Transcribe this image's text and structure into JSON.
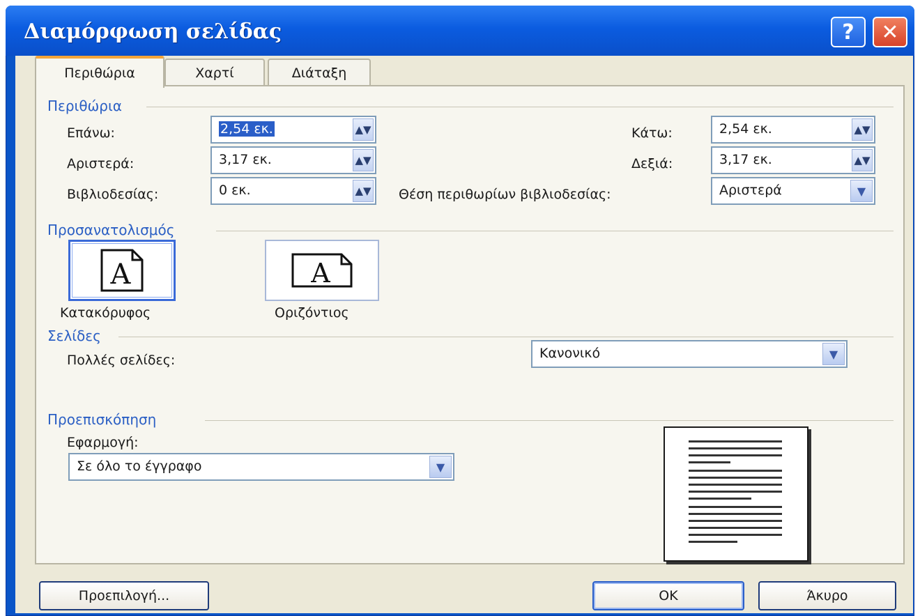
{
  "window": {
    "title": "Διαμόρφωση σελίδας",
    "help_label": "?",
    "close_label": "✕"
  },
  "tabs": [
    {
      "label": "Περιθώρια",
      "active": true
    },
    {
      "label": "Χαρτί",
      "active": false
    },
    {
      "label": "Διάταξη",
      "active": false
    }
  ],
  "margins": {
    "group_label": "Περιθώρια",
    "top_label": "Επάνω:",
    "top_value": "2,54 εκ.",
    "bottom_label": "Κάτω:",
    "bottom_value": "2,54 εκ.",
    "left_label": "Αριστερά:",
    "left_value": "3,17 εκ.",
    "right_label": "Δεξιά:",
    "right_value": "3,17 εκ.",
    "gutter_label": "Βιβλιοδεσίας:",
    "gutter_value": "0 εκ.",
    "gutter_pos_label": "Θέση περιθωρίων βιβλιοδεσίας:",
    "gutter_pos_value": "Αριστερά"
  },
  "orientation": {
    "group_label": "Προσανατολισμός",
    "portrait_label": "Κατακόρυφος",
    "landscape_label": "Οριζόντιος",
    "icon_letter": "A",
    "selected": "portrait"
  },
  "pages": {
    "group_label": "Σελίδες",
    "multiple_label": "Πολλές σελίδες:",
    "multiple_value": "Κανονικό"
  },
  "preview": {
    "group_label": "Προεπισκόπηση",
    "apply_label": "Εφαρμογή:",
    "apply_value": "Σε όλο το έγγραφο"
  },
  "buttons": {
    "default_label": "Προεπιλογή...",
    "ok_label": "OK",
    "cancel_label": "Άκυρο"
  },
  "icons": {
    "spinner": "spinner-arrows-icon",
    "dropdown": "chevron-down-icon"
  }
}
